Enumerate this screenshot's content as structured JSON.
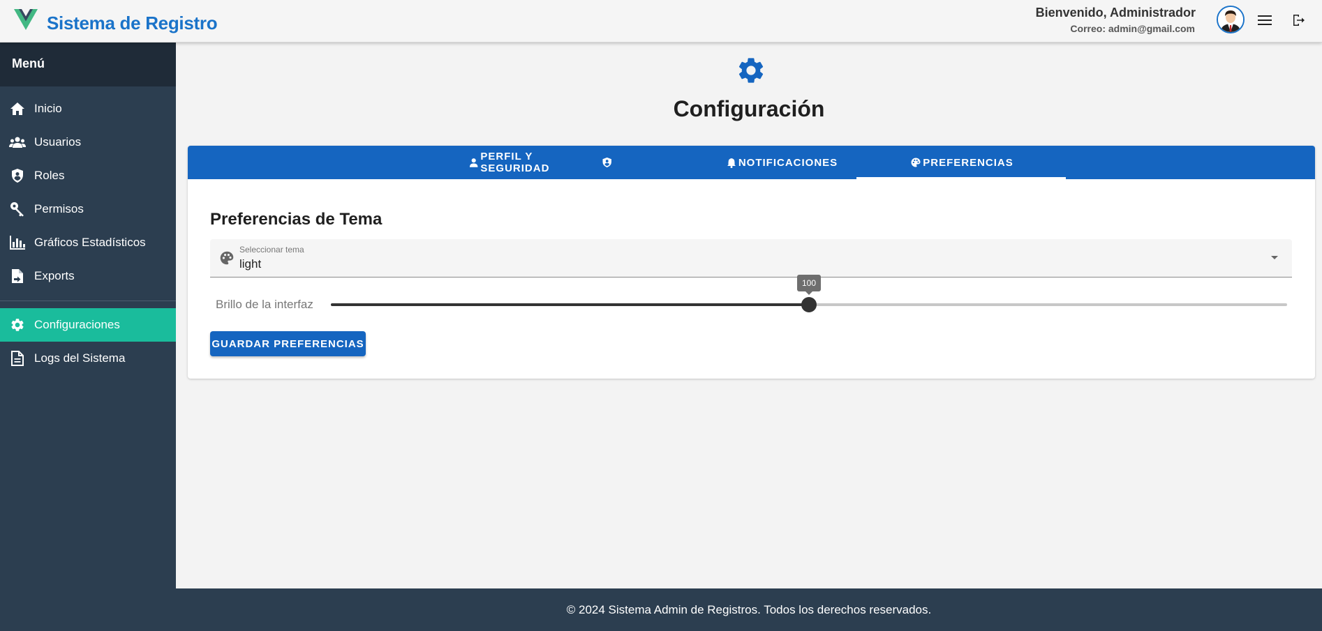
{
  "header": {
    "app_title": "Sistema de Registro",
    "welcome": "Bienvenido, Administrador",
    "email": "Correo: admin@gmail.com",
    "logo_colors": [
      "#42b883",
      "#35495e"
    ],
    "avatar_icon": "user-avatar",
    "menu_icon": "hamburger-menu-icon",
    "logout_icon": "logout-icon"
  },
  "sidebar": {
    "title": "Menú",
    "items": [
      {
        "label": "Inicio",
        "icon": "home-icon"
      },
      {
        "label": "Usuarios",
        "icon": "users-icon"
      },
      {
        "label": "Roles",
        "icon": "shield-icon"
      },
      {
        "label": "Permisos",
        "icon": "key-icon"
      },
      {
        "label": "Gráficos Estadísticos",
        "icon": "bar-chart-icon"
      },
      {
        "label": "Exports",
        "icon": "file-export-icon"
      },
      {
        "label": "Configuraciones",
        "icon": "gear-icon",
        "active": true
      },
      {
        "label": "Logs del Sistema",
        "icon": "document-icon"
      }
    ]
  },
  "page": {
    "title": "Configuración",
    "icon": "gear-icon"
  },
  "tabs": [
    {
      "label": "PERFIL Y SEGURIDAD",
      "icon": "person-icon"
    },
    {
      "label": "NOTIFICACIONES",
      "icon": "bell-icon"
    },
    {
      "label": "PREFERENCIAS",
      "icon": "palette-icon",
      "active": true
    }
  ],
  "preferences": {
    "section_title": "Preferencias de Tema",
    "theme_select": {
      "label": "Seleccionar tema",
      "value": "light"
    },
    "brightness": {
      "label": "Brillo de la interfaz",
      "value": 100,
      "fill_fraction": 0.5
    },
    "save_label": "GUARDAR PREFERENCIAS"
  },
  "footer": {
    "text": "© 2024 Sistema Admin de Registros. Todos los derechos reservados."
  },
  "colors": {
    "primary": "#1565c0",
    "brand_text": "#1a73c9",
    "sidebar_bg": "#2c3e50",
    "active_item": "#1abc9c"
  }
}
